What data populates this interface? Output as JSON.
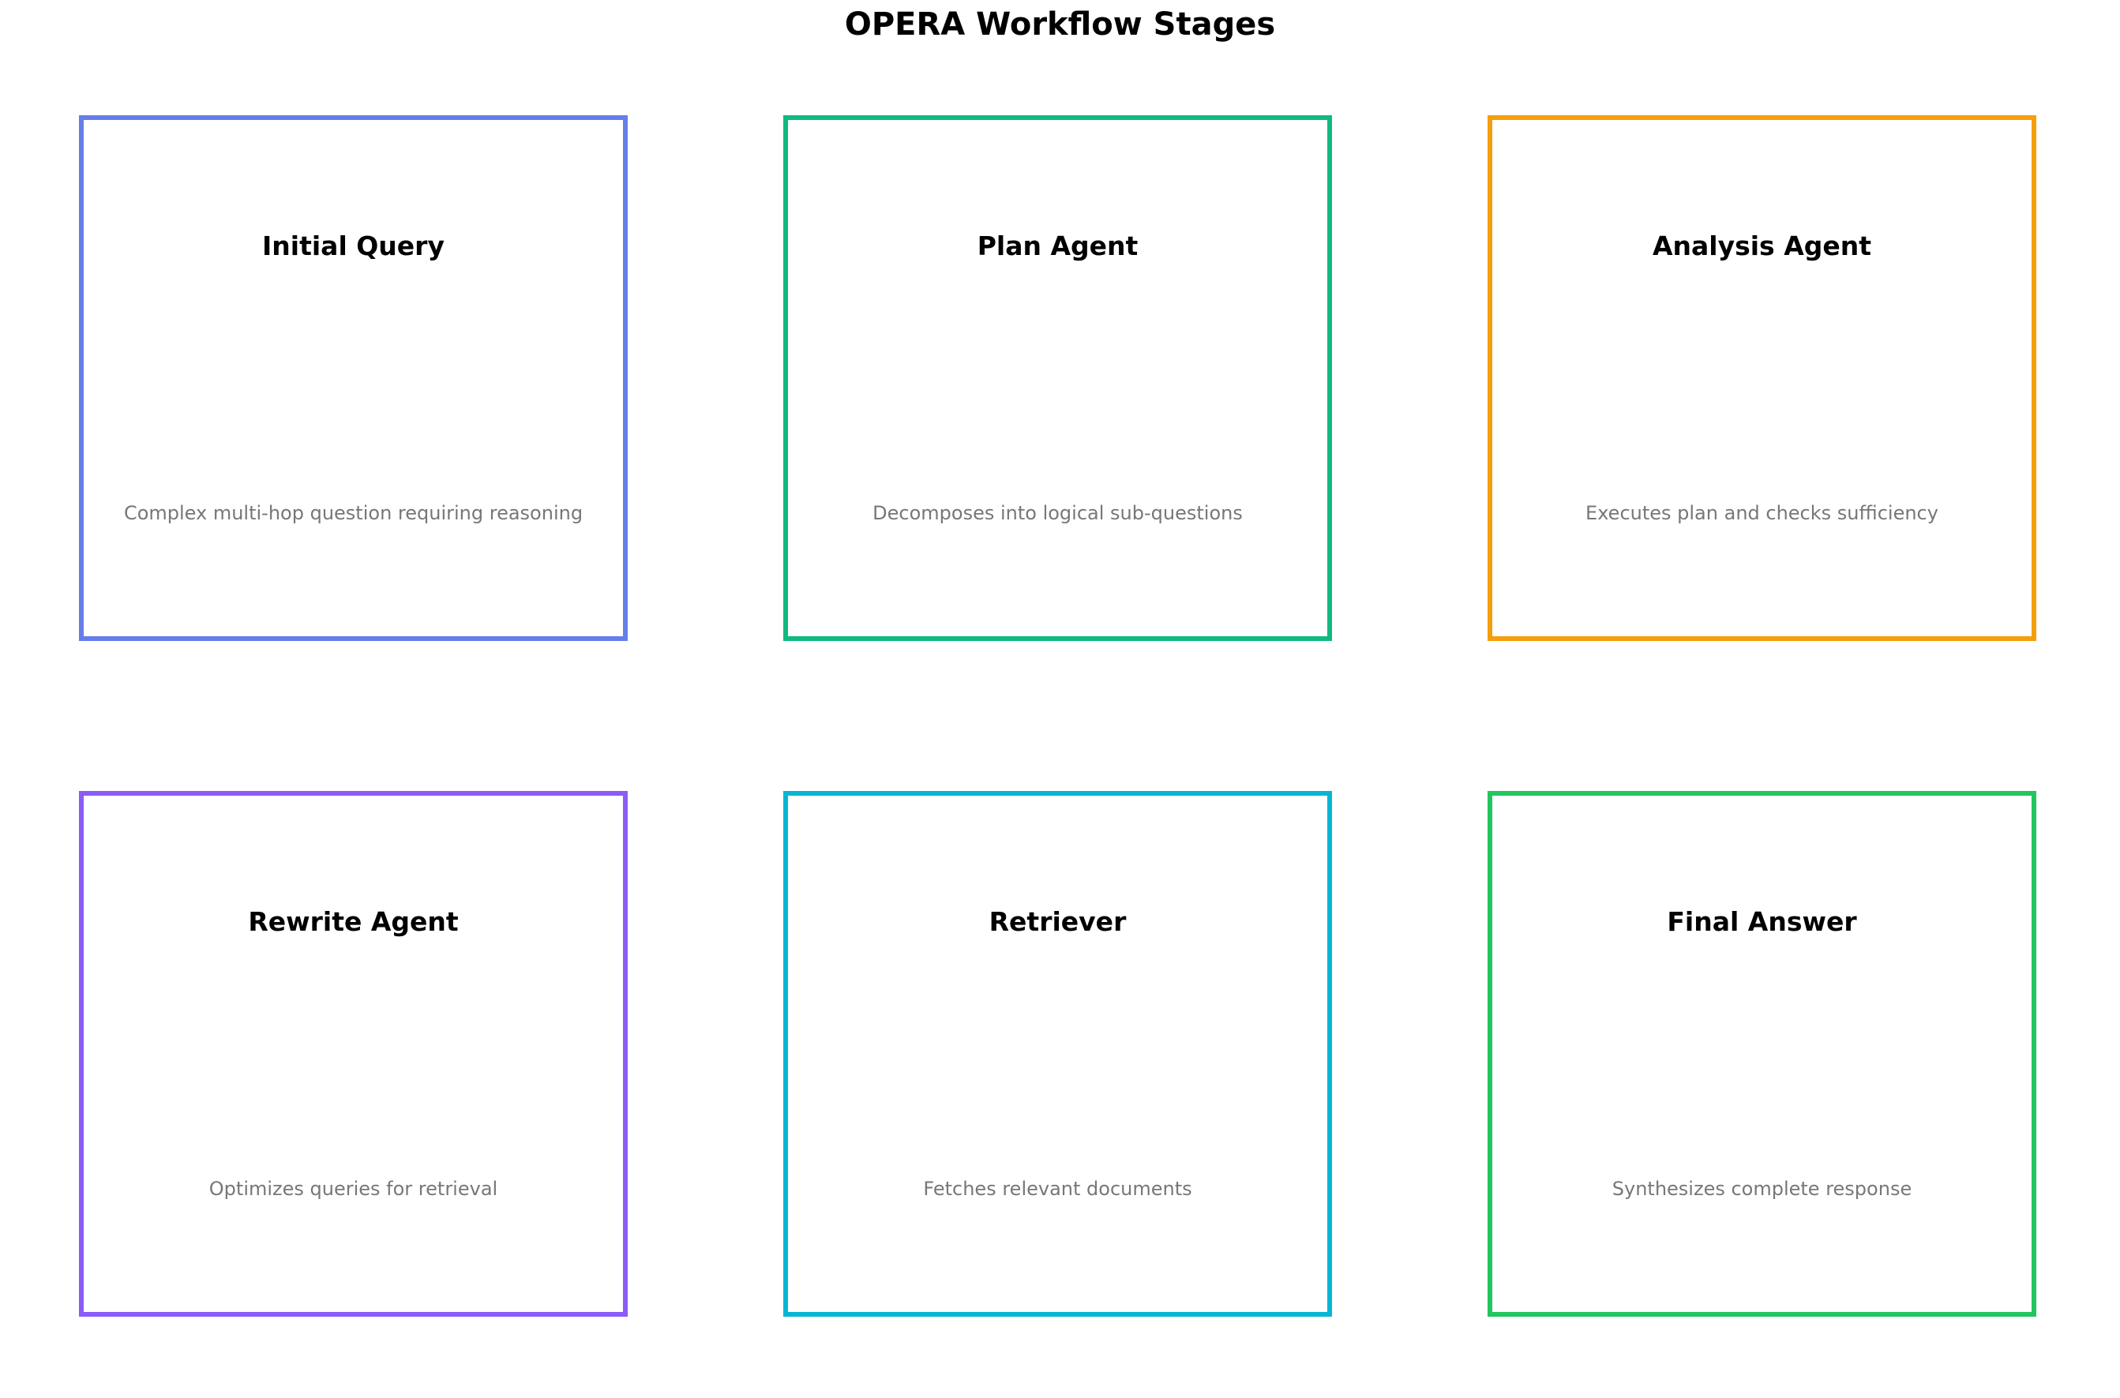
{
  "title": "OPERA Workflow Stages",
  "stages": [
    {
      "title": "Initial Query",
      "description": "Complex multi-hop question requiring reasoning",
      "color": "#667eea"
    },
    {
      "title": "Plan Agent",
      "description": "Decomposes into logical sub-questions",
      "color": "#10b981"
    },
    {
      "title": "Analysis Agent",
      "description": "Executes plan and checks sufficiency",
      "color": "#f59e0b"
    },
    {
      "title": "Rewrite Agent",
      "description": "Optimizes queries for retrieval",
      "color": "#8b5cf6"
    },
    {
      "title": "Retriever",
      "description": "Fetches relevant documents",
      "color": "#06b6d4"
    },
    {
      "title": "Final Answer",
      "description": "Synthesizes complete response",
      "color": "#22c55e"
    }
  ]
}
